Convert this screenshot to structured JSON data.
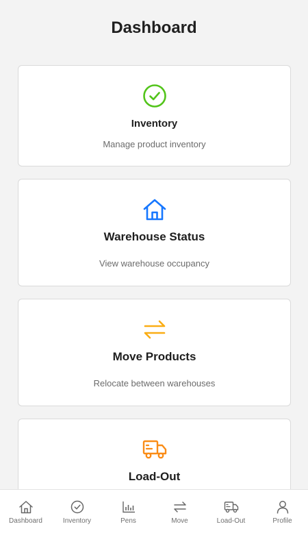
{
  "header": {
    "title": "Dashboard"
  },
  "cards": [
    {
      "id": "inventory",
      "title": "Inventory",
      "subtitle": "Manage product inventory",
      "icon": "check-circle-icon",
      "color": "#52c41a"
    },
    {
      "id": "warehouse",
      "title": "Warehouse Status",
      "subtitle": "View warehouse occupancy",
      "icon": "home-icon",
      "color": "#1677ff"
    },
    {
      "id": "move",
      "title": "Move Products",
      "subtitle": "Relocate between warehouses",
      "icon": "swap-icon",
      "color": "#faad14"
    },
    {
      "id": "loadout",
      "title": "Load-Out",
      "subtitle": "",
      "icon": "truck-icon",
      "color": "#fa8c16"
    }
  ],
  "tabbar": {
    "icon_color": "#666666",
    "items": [
      {
        "label": "Dashboard",
        "icon": "home-icon"
      },
      {
        "label": "Inventory",
        "icon": "check-circle-icon"
      },
      {
        "label": "Pens",
        "icon": "bar-chart-icon"
      },
      {
        "label": "Move",
        "icon": "swap-icon"
      },
      {
        "label": "Load-Out",
        "icon": "truck-icon"
      },
      {
        "label": "Profile",
        "icon": "user-icon"
      }
    ]
  }
}
